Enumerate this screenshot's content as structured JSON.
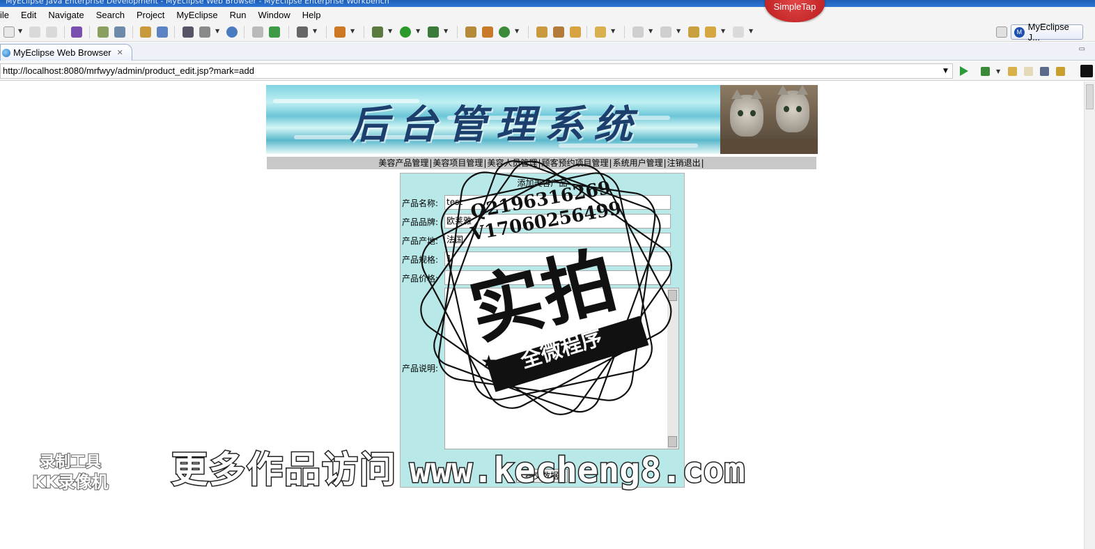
{
  "window": {
    "title": "MyEclipse Java Enterprise Development - MyEclipse Web Browser - MyEclipse Enterprise Workbench"
  },
  "menubar": {
    "items": [
      "ile",
      "Edit",
      "Navigate",
      "Search",
      "Project",
      "MyEclipse",
      "Run",
      "Window",
      "Help"
    ]
  },
  "overlay": {
    "simpletap": "SimpleTap"
  },
  "toolbar": {
    "perspective_label": "MyEclipse J..."
  },
  "editor_tab": {
    "label": "MyEclipse Web Browser",
    "close": "✕"
  },
  "address": {
    "url": "http://localhost:8080/mrfwyy/admin/product_edit.jsp?mark=add"
  },
  "page": {
    "banner_title": "后台管理系统",
    "nav": [
      "美容产品管理",
      "美容项目管理",
      "美容人员管理",
      "顾客预约项目管理",
      "系统用户管理",
      "注销退出"
    ],
    "form_title": "添加美容产品",
    "fields": [
      {
        "label": "产品名称:",
        "value": "test"
      },
      {
        "label": "产品品牌:",
        "value": "欧莱雅"
      },
      {
        "label": "产品产地:",
        "value": "法国"
      },
      {
        "label": "产品规格:",
        "value": "1"
      },
      {
        "label": "产品价格:",
        "value": ""
      }
    ],
    "description_label": "产品说明:",
    "submit_label": "提交数据"
  },
  "watermarks": {
    "qq": "Q2196316269",
    "wechat": "V17060256499",
    "big": "实拍",
    "band": "全微程序",
    "promo_cn": "更多作品访问",
    "promo_url": "www.kecheng8.com",
    "recorder_line1": "录制工具",
    "recorder_line2": "KK录像机"
  }
}
